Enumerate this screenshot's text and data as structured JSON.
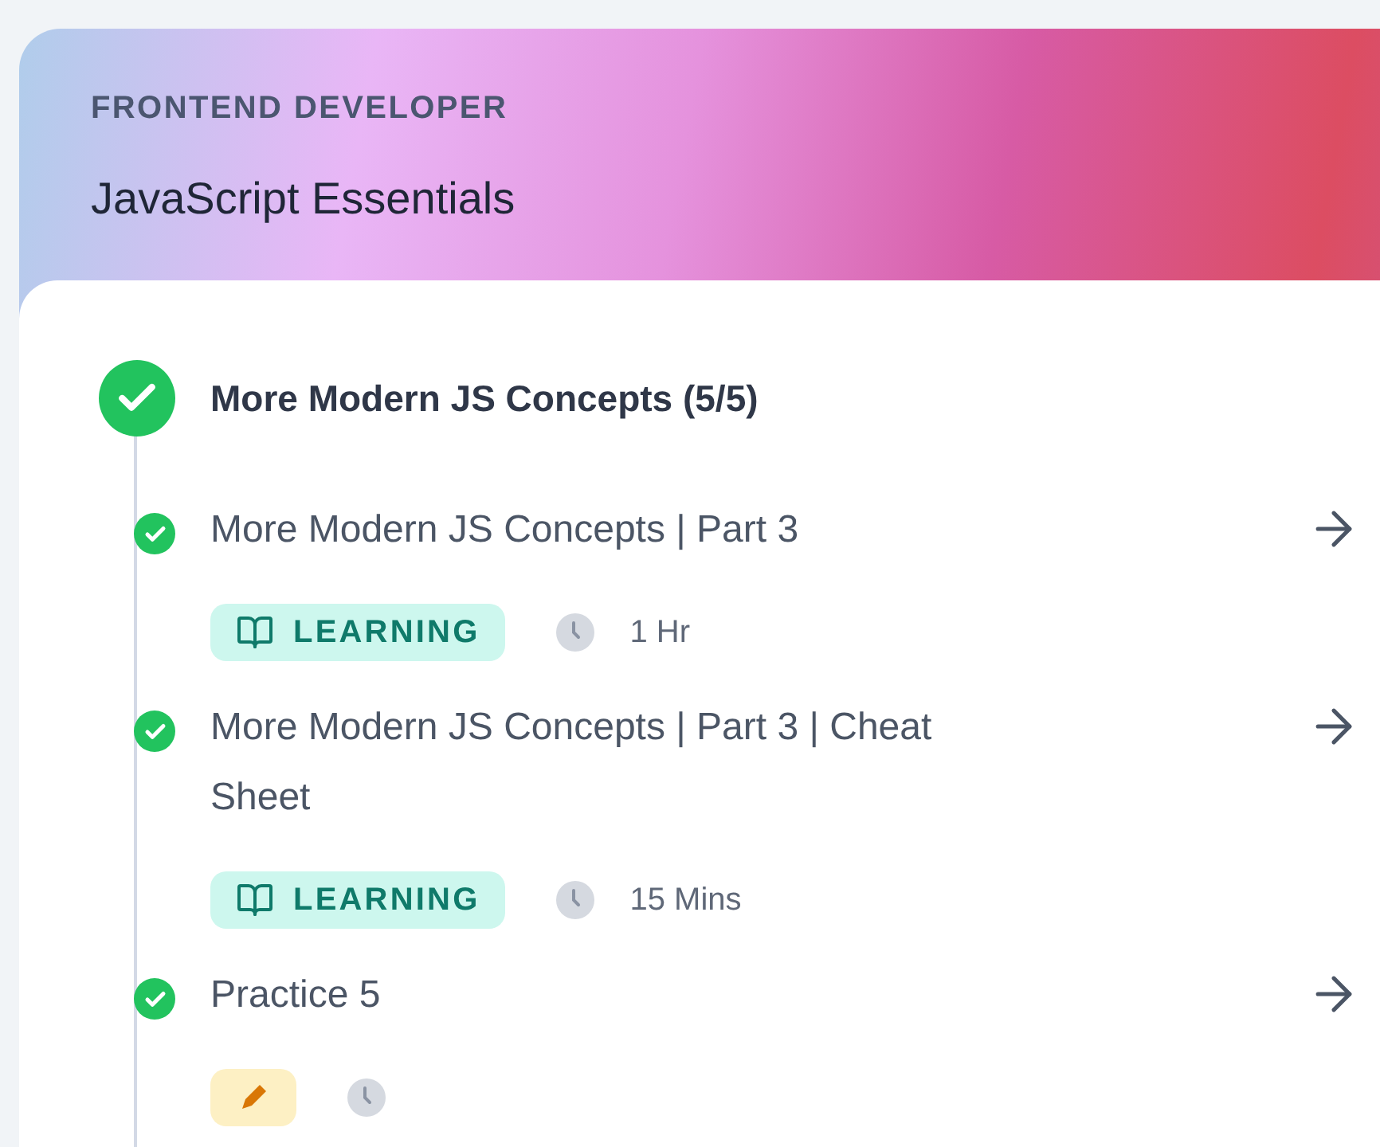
{
  "header": {
    "track": "FRONTEND DEVELOPER",
    "course": "JavaScript Essentials"
  },
  "section": {
    "title": "More Modern JS Concepts (5/5)",
    "completed": true
  },
  "items": [
    {
      "title": "More Modern JS Concepts | Part 3",
      "completed": true,
      "badge": {
        "kind": "learning",
        "label": "LEARNING"
      },
      "duration": "1 Hr"
    },
    {
      "title": "More Modern JS Concepts | Part 3 | Cheat Sheet",
      "completed": true,
      "badge": {
        "kind": "learning",
        "label": "LEARNING"
      },
      "duration": "15 Mins"
    },
    {
      "title": "Practice 5",
      "completed": true,
      "badge": {
        "kind": "practice"
      }
    }
  ]
}
